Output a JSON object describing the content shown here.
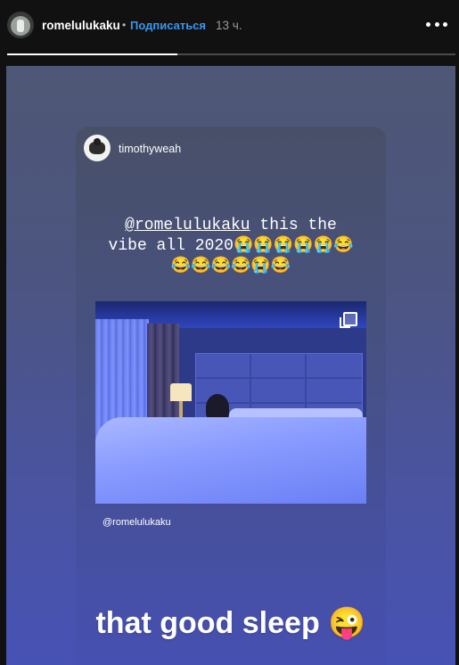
{
  "header": {
    "username": "romelulukaku",
    "separator": "•",
    "follow_label": "Подписаться",
    "time_ago": "13 ч.",
    "more_icon": "more-horizontal-icon"
  },
  "progress": {
    "fraction": 0.38
  },
  "story": {
    "reshared_post": {
      "username": "timothyweah",
      "mention": "@romelulukaku",
      "text_line1_rest": " this the",
      "text_line2": "vibe all 2020😭😭😭😭😭😂",
      "text_line3": "😂😂😂😂😭😂",
      "photo_caption": "@romelulukaku",
      "gallery_icon": "multiple-photos-icon"
    },
    "overlay_text": "that good sleep 😜"
  }
}
